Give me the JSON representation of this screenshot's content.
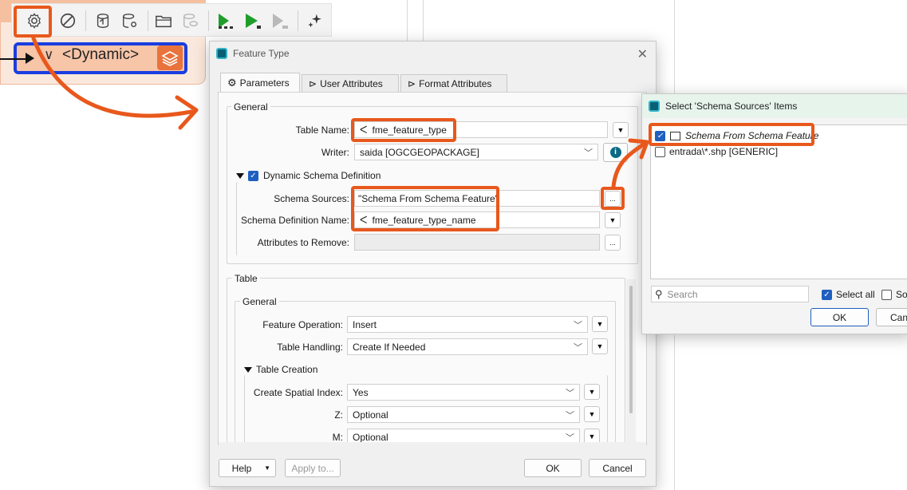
{
  "toolbar": {
    "icons": [
      "gear-icon",
      "disable-icon",
      "import-icon",
      "database-settings-icon",
      "folder-icon",
      "inspect-icon",
      "run-to-icon",
      "run-icon",
      "run-disabled-icon",
      "sparkle-icon"
    ]
  },
  "writer_node": {
    "label": "<Dynamic>",
    "chevron": "∨"
  },
  "feature_type_dialog": {
    "title": "Feature Type",
    "tabs": [
      "Parameters",
      "User Attributes",
      "Format Attributes"
    ],
    "general_group": "General",
    "table_name_label": "Table Name:",
    "table_name_value": "fme_feature_type",
    "writer_label": "Writer:",
    "writer_value": "saida [OGCGEOPACKAGE]",
    "dynamic_schema_label": "Dynamic Schema Definition",
    "schema_sources_label": "Schema Sources:",
    "schema_sources_value": "\"Schema From Schema Feature\"",
    "schema_def_name_label": "Schema Definition Name:",
    "schema_def_name_value": "fme_feature_type_name",
    "attributes_remove_label": "Attributes to Remove:",
    "ellipsis": "...",
    "table_group": "Table",
    "table_general_group": "General",
    "feature_operation_label": "Feature Operation:",
    "feature_operation_value": "Insert",
    "table_handling_label": "Table Handling:",
    "table_handling_value": "Create If Needed",
    "table_creation_label": "Table Creation",
    "spatial_index_label": "Create Spatial Index:",
    "spatial_index_value": "Yes",
    "z_label": "Z:",
    "z_value": "Optional",
    "m_label": "M:",
    "m_value": "Optional",
    "help_label": "Help",
    "apply_label": "Apply to...",
    "ok_label": "OK",
    "cancel_label": "Cancel"
  },
  "schema_dialog": {
    "title": "Select 'Schema Sources' Items",
    "items": [
      {
        "label": "Schema From Schema Feature",
        "checked": true
      },
      {
        "label": "entrada\\*.shp [GENERIC]",
        "checked": false
      }
    ],
    "search_placeholder": "Search",
    "select_all_label": "Select all",
    "second_checkbox_label": "So",
    "ok_label": "OK",
    "cancel_label": "Canc"
  },
  "colors": {
    "highlight": "#e8581c",
    "node_border": "#1a3ee0",
    "accent": "#1f5fbf"
  }
}
